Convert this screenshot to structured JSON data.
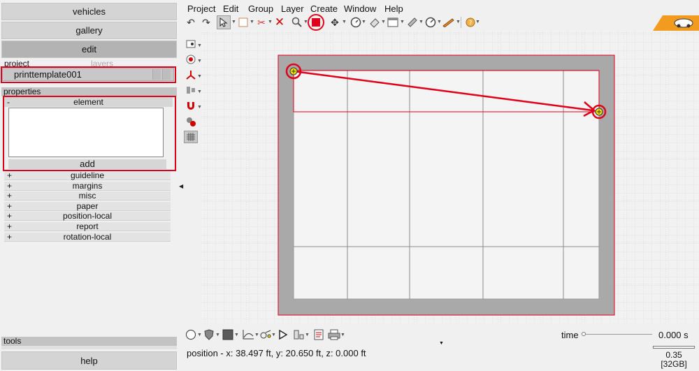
{
  "left": {
    "nav": {
      "vehicles": "vehicles",
      "gallery": "gallery",
      "edit": "edit"
    },
    "tabs": {
      "project": "project",
      "layers": "layers"
    },
    "project_item": "printtemplate001",
    "properties_header": "properties",
    "element": {
      "sign": "-",
      "label": "element",
      "add": "add"
    },
    "props": [
      {
        "sign": "+",
        "label": "guideline"
      },
      {
        "sign": "+",
        "label": "margins"
      },
      {
        "sign": "+",
        "label": "misc"
      },
      {
        "sign": "+",
        "label": "paper"
      },
      {
        "sign": "+",
        "label": "position-local"
      },
      {
        "sign": "+",
        "label": "report"
      },
      {
        "sign": "+",
        "label": "rotation-local"
      }
    ],
    "tools_header": "tools",
    "help": "help"
  },
  "menu": [
    "Project",
    "Edit",
    "Group",
    "Layer",
    "Create",
    "Window",
    "Help"
  ],
  "toolbar_icons": [
    "undo-icon",
    "redo-icon",
    "select-icon",
    "rectangle-icon",
    "cut-icon",
    "delete-icon",
    "zoom-icon",
    "stop-icon",
    "move-icon",
    "clock-icon",
    "eraser-icon",
    "window-icon",
    "ruler-icon",
    "gauge-icon",
    "pencil-icon",
    "help-icon"
  ],
  "bottom": {
    "time_label": "time",
    "time_value": "0.000 s",
    "time_fraction": 0,
    "status": "position - x: 38.497 ft, y: 20.650 ft, z: 0.000 ft",
    "mem_value": "0.35",
    "mem_total": "[32GB]"
  },
  "colors": {
    "accent_red": "#e0001b",
    "logo_orange": "#f39b1e",
    "paper_gray": "#a9a9a9"
  }
}
